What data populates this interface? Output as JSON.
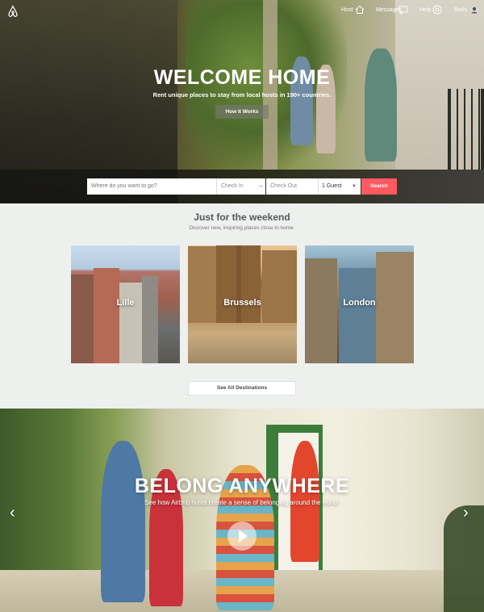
{
  "nav": {
    "host_label": "Host",
    "messages_label": "Messages",
    "help_label": "Help",
    "user_label": "Boris",
    "icons": [
      "airbnb-logo-icon",
      "home-icon",
      "message-icon",
      "help-icon",
      "avatar-icon"
    ]
  },
  "hero": {
    "title": "WELCOME HOME",
    "subtitle": "Rent unique places to stay from local hosts in 190+ countries.",
    "how_it_works": "How It Works"
  },
  "search": {
    "where_placeholder": "Where do you want to go?",
    "check_in": "Check In",
    "check_out": "Check Out",
    "guests": "1 Guest",
    "button": "Search"
  },
  "weekend": {
    "title": "Just for the weekend",
    "subtitle": "Discover new, inspiring places close to home.",
    "cards": [
      {
        "label": "Lille"
      },
      {
        "label": "Brussels"
      },
      {
        "label": "London"
      }
    ],
    "see_all": "See All Destinations"
  },
  "belong": {
    "title": "BELONG ANYWHERE",
    "subtitle": "See how Airbnb hosts create a sense of belonging around the world."
  },
  "colors": {
    "accent": "#ff5a5f",
    "section_bg": "#eef0ee"
  }
}
